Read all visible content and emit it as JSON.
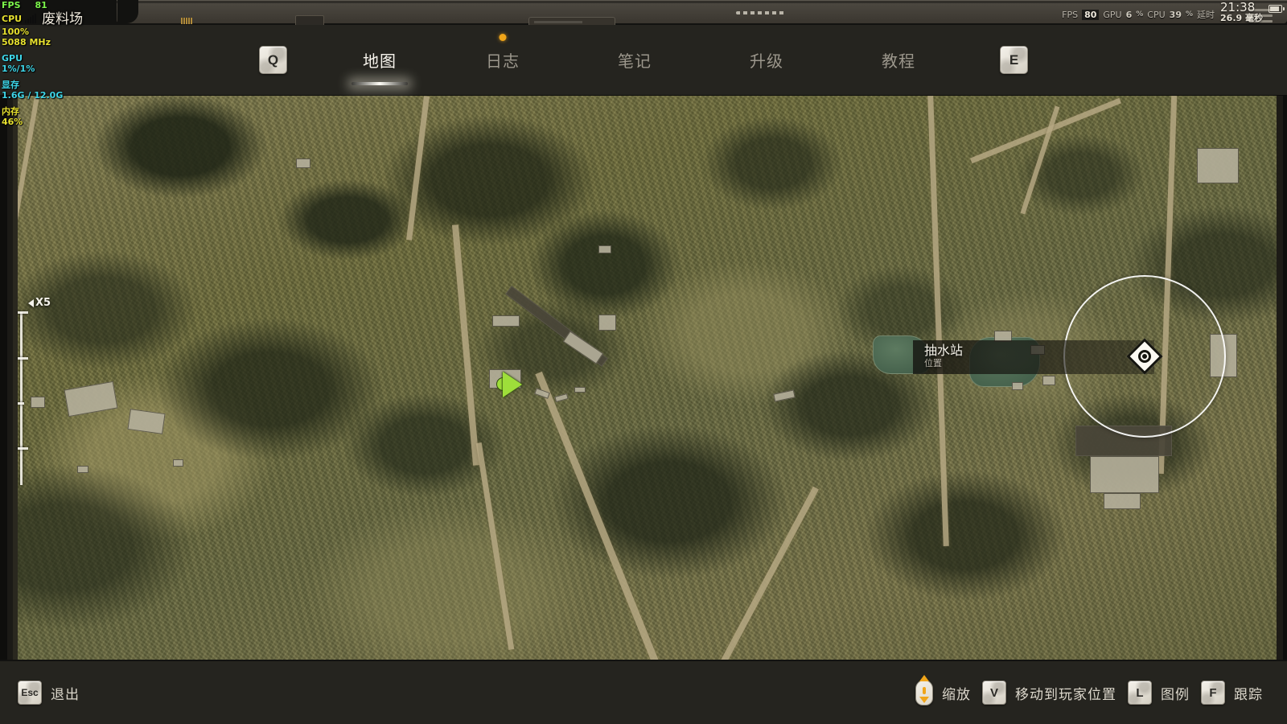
{
  "perf_overlay": {
    "fps_label": "FPS",
    "fps_value": "81",
    "cpu_label": "CPU",
    "cpu_usage": "100%",
    "cpu_clock": "5088 MHz",
    "gpu_label": "GPU",
    "gpu_usage": "1%/1%",
    "vram_label": "显存",
    "vram_value": "1.6G / 12.0G",
    "mem_label": "内存",
    "mem_value": "46%",
    "zone_name": "废料场",
    "signal_icon": "signal-bars-icon"
  },
  "hud_top_right": {
    "fps_label": "FPS",
    "fps_value": "80",
    "gpu_label": "GPU",
    "gpu_value": "6",
    "gpu_unit": "%",
    "cpu_label": "CPU",
    "cpu_value": "39",
    "cpu_unit": "%",
    "latency_label": "延时",
    "latency_value": "26.9 毫秒",
    "clock": "21:38",
    "battery_icon": "battery-icon"
  },
  "nav": {
    "left_key": "Q",
    "right_key": "E",
    "tabs": [
      {
        "label": "地图",
        "active": true,
        "badge": false
      },
      {
        "label": "日志",
        "active": false,
        "badge": true
      },
      {
        "label": "笔记",
        "active": false,
        "badge": false
      },
      {
        "label": "升级",
        "active": false,
        "badge": false
      },
      {
        "label": "教程",
        "active": false,
        "badge": false
      }
    ]
  },
  "map": {
    "zoom_level": "X5",
    "player_marker_icon": "player-arrow-icon",
    "objective_marker_icon": "objective-diamond-icon",
    "tooltip": {
      "title": "抽水站",
      "subtitle": "位置"
    }
  },
  "bottom_bar": {
    "exit": {
      "key": "Esc",
      "label": "退出"
    },
    "hints": [
      {
        "key": "mouse-wheel-icon",
        "label": "缩放"
      },
      {
        "key": "V",
        "label": "移动到玩家位置"
      },
      {
        "key": "L",
        "label": "图例"
      },
      {
        "key": "F",
        "label": "跟踪"
      }
    ]
  },
  "colors": {
    "accent_orange": "#f0a519",
    "player_green": "#9ede3a",
    "panel_dark": "#25241f",
    "text_light": "#f6f3ea",
    "text_dim": "#9c978c"
  }
}
